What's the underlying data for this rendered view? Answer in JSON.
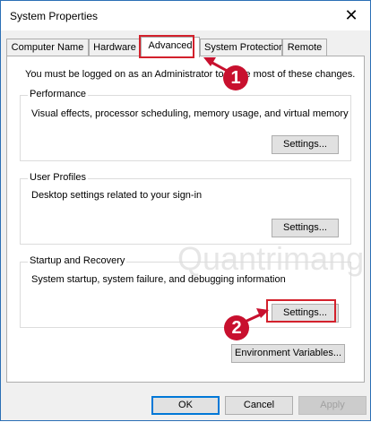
{
  "window": {
    "title": "System Properties",
    "close_glyph": "✕"
  },
  "tabs": [
    {
      "label": "Computer Name",
      "active": false
    },
    {
      "label": "Hardware",
      "active": false
    },
    {
      "label": "Advanced",
      "active": true
    },
    {
      "label": "System Protection",
      "active": false
    },
    {
      "label": "Remote",
      "active": false
    }
  ],
  "advanced": {
    "admin_note": "You must be logged on as an Administrator to make most of these changes.",
    "performance": {
      "label": "Performance",
      "description": "Visual effects, processor scheduling, memory usage, and virtual memory",
      "button": "Settings..."
    },
    "user_profiles": {
      "label": "User Profiles",
      "description": "Desktop settings related to your sign-in",
      "button": "Settings..."
    },
    "startup_recovery": {
      "label": "Startup and Recovery",
      "description": "System startup, system failure, and debugging information",
      "button": "Settings..."
    },
    "env_button": "Environment Variables..."
  },
  "footer": {
    "ok": "OK",
    "cancel": "Cancel",
    "apply": "Apply"
  },
  "annotations": {
    "step1": "1",
    "step2": "2",
    "color": "#c8102e"
  },
  "watermark": "Quantrimang"
}
